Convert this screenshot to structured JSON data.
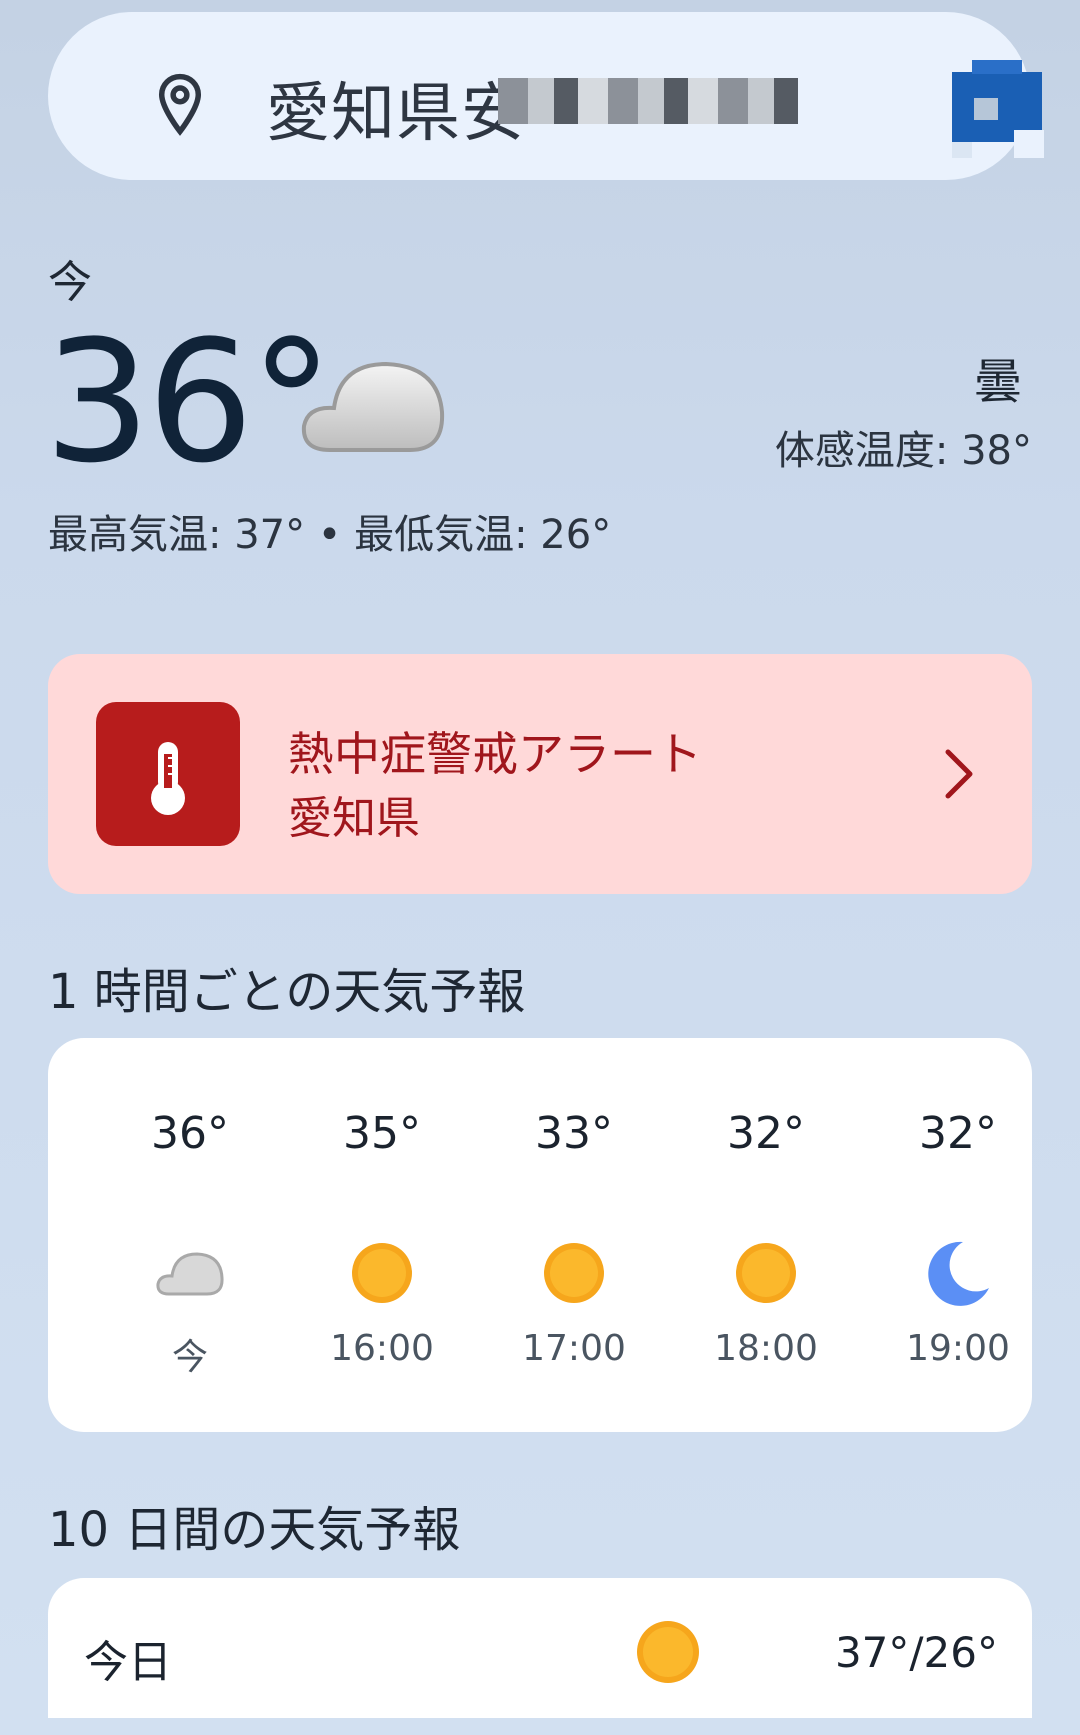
{
  "search": {
    "location_text": "愛知県安",
    "pin_icon": "location-pin-icon",
    "avatar_icon": "profile-avatar-icon"
  },
  "current": {
    "label": "今",
    "temperature": "36°",
    "icon": "cloudy-icon",
    "condition": "曇",
    "feels_like": "体感温度: 38°",
    "high_low": "最高気温: 37° • 最低気温: 26°"
  },
  "alert": {
    "title": "熱中症警戒アラート",
    "region": "愛知県",
    "icon": "thermometer-icon",
    "color": "#b71c1c"
  },
  "hourly": {
    "title": "1 時間ごとの天気予報",
    "items": [
      {
        "temp": "36°",
        "icon": "cloudy-icon",
        "time": "今"
      },
      {
        "temp": "35°",
        "icon": "sunny-icon",
        "time": "16:00"
      },
      {
        "temp": "33°",
        "icon": "sunny-icon",
        "time": "17:00"
      },
      {
        "temp": "32°",
        "icon": "sunny-icon",
        "time": "18:00"
      },
      {
        "temp": "32°",
        "icon": "moon-icon",
        "time": "19:00"
      }
    ]
  },
  "daily": {
    "title": "10 日間の天気予報",
    "items": [
      {
        "day": "今日",
        "icon": "sunny-icon",
        "range": "37°/26°"
      }
    ]
  }
}
